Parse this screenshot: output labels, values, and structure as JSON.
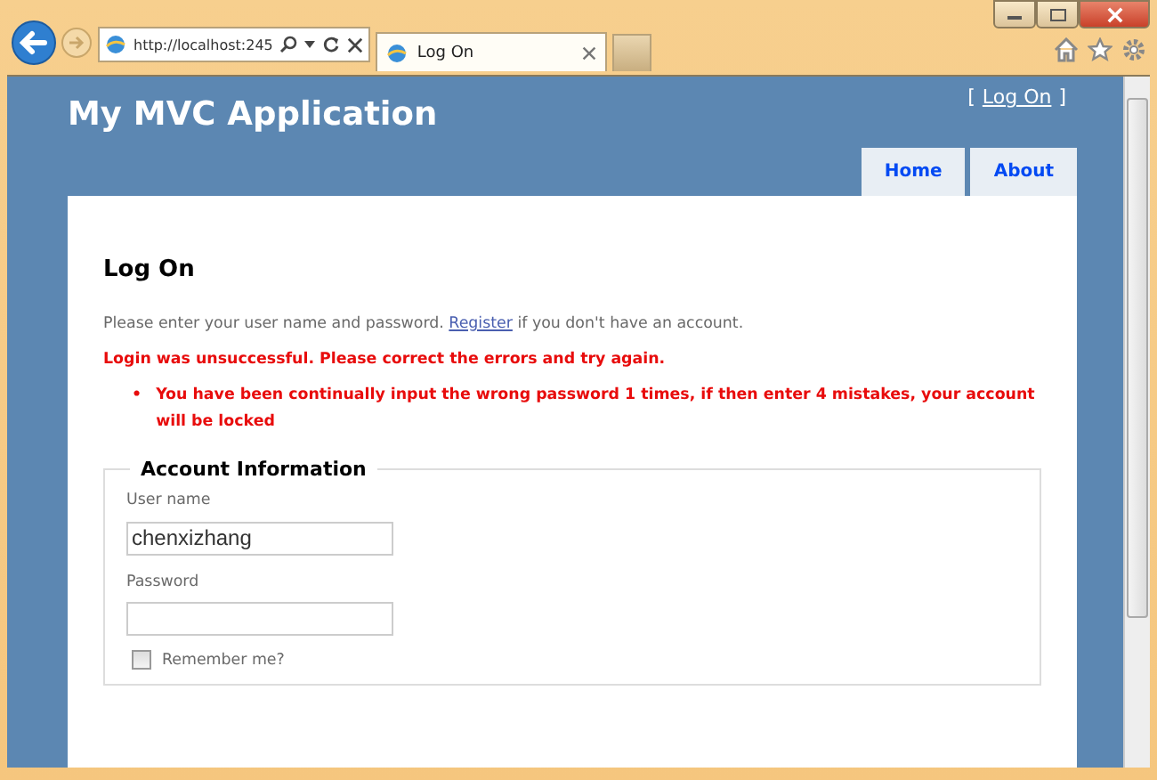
{
  "browser": {
    "address": "http://localhost:245",
    "tabs": [
      {
        "label": "Log On",
        "selected": true
      }
    ]
  },
  "header": {
    "title": "My MVC Application",
    "login": {
      "prefix": "[",
      "link": "Log On",
      "suffix": "]"
    }
  },
  "nav": [
    {
      "label": "Home"
    },
    {
      "label": "About"
    }
  ],
  "main": {
    "heading": "Log On",
    "intro": {
      "before": "Please enter your user name and password.",
      "link": "Register",
      "after": "if you don't have an account."
    },
    "error_summary": "Login was unsuccessful. Please correct the errors and try again.",
    "errors": [
      {
        "bullet": "•",
        "text": "You have been continually input the wrong password 1 times, if then enter 4 mistakes, your account will be locked"
      }
    ],
    "fieldset": {
      "legend": "Account Information",
      "fields": [
        {
          "kind": "text",
          "label": "User name",
          "value": "chenxizhang"
        },
        {
          "kind": "password",
          "label": "Password"
        }
      ],
      "remember": {
        "label": "Remember me?",
        "checked": false
      }
    }
  }
}
